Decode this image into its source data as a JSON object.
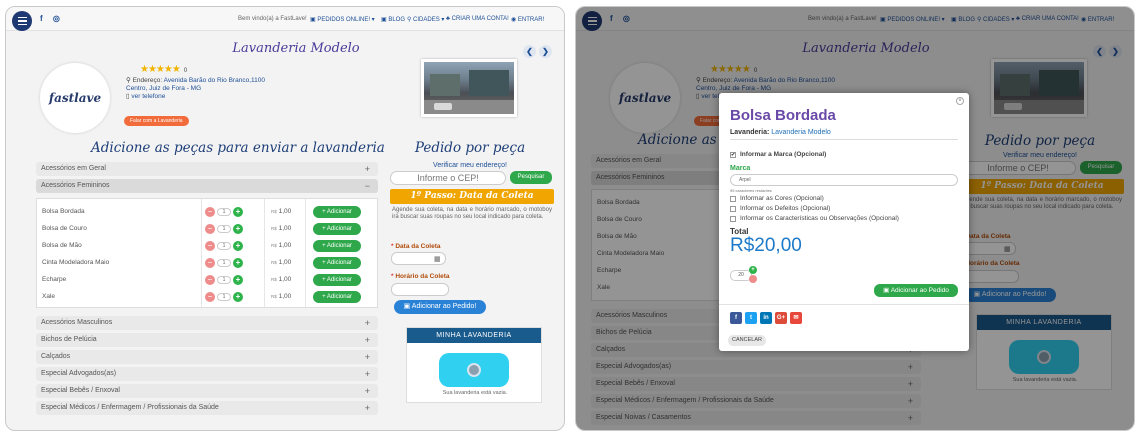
{
  "topbar": {
    "social": "f ◎",
    "welcome": "Bem vindo(a) a FastLave!",
    "pedidos": "▣ PEDIDOS ONLINE! ▾",
    "blog": "▣ BLOG",
    "cidades": "⚲ CIDADES ▾",
    "criar": "♣ CRIAR UMA CONTA!",
    "entrar": "◉ ENTRAR!"
  },
  "store": {
    "title": "Lavanderia Modelo",
    "logo": "fastlave",
    "stars": "★★★★★",
    "rating_count": "0",
    "address_label": "Endereço:",
    "address_line1": "Avenida Barão do Rio Branco,1100",
    "address_line2": "Centro, Juiz de Fora - MG",
    "phone_link": "ver telefone",
    "talk_button": "Falar com a Lavanderia"
  },
  "main": {
    "heading": "Adicione as peças para enviar a lavanderia",
    "categories_top": [
      "Acessórios em Geral",
      "Acessórios Femininos"
    ],
    "items": [
      {
        "name": "Bolsa Bordada",
        "qty": "1",
        "currency": "R$",
        "price": "1,00",
        "button": "+ Adicionar"
      },
      {
        "name": "Bolsa de Couro",
        "qty": "1",
        "currency": "R$",
        "price": "1,00",
        "button": "+ Adicionar"
      },
      {
        "name": "Bolsa de Mão",
        "qty": "1",
        "currency": "R$",
        "price": "1,00",
        "button": "+ Adicionar"
      },
      {
        "name": "Cinta Modeladora Maio",
        "qty": "1",
        "currency": "R$",
        "price": "1,00",
        "button": "+ Adicionar"
      },
      {
        "name": "Echarpe",
        "qty": "1",
        "currency": "R$",
        "price": "1,00",
        "button": "+ Adicionar"
      },
      {
        "name": "Xale",
        "qty": "1",
        "currency": "R$",
        "price": "1,00",
        "button": "+ Adicionar"
      }
    ],
    "categories_bottom": [
      "Acessórios Masculinos",
      "Bichos de Pelúcia",
      "Calçados",
      "Especial Advogados(as)",
      "Especial Bebês / Enxoval",
      "Especial Médicos / Enfermagem / Profissionais da Saúde"
    ],
    "categories_bottom_right": [
      "Acessórios Masculinos",
      "Bichos de Pelúcia",
      "Calçados",
      "Especial Advogados(as)",
      "Especial Bebês / Enxoval",
      "Especial Médicos / Enfermagem / Profissionais da Saúde",
      "Especial Noivas / Casamentos"
    ]
  },
  "pedido": {
    "title": "Pedido por peça",
    "verify": "Verificar meu endereço!",
    "cep_placeholder": "Informe o CEP!",
    "pesquisar": "Pesquisar",
    "passo": "1º Passo: Data da Coleta",
    "agende": "Agende sua coleta, na data e horário marcado, o motoboy irá buscar suas roupas no seu local indicado para coleta.",
    "data_label": "Data da Coleta",
    "hora_label": "Horário da Coleta",
    "add_button": "Adicionar ao Pedido!",
    "minha": "MINHA LAVANDERIA",
    "empty": "Sua lavanderia está vazia."
  },
  "modal": {
    "title": "Bolsa Bordada",
    "lav_label": "Lavanderia:",
    "lav_name": "Lavanderia Modelo",
    "informar_marca": "Informar a Marca (Opcional)",
    "marca_label": "Marca",
    "marca_value": "Arpel",
    "restantes": "95 caracteres restantes",
    "cores": "Informar as Cores (Opcional)",
    "defeitos": "Informar os Defeitos (Opcional)",
    "caracteristicas": "Informar os Características ou Observações (Opcional)",
    "total_label": "Total",
    "total": "R$20,00",
    "qty": "20",
    "add": "Adicionar ao Pedido",
    "cancel": "CANCELAR",
    "shares": [
      "f",
      "t",
      "in",
      "G+",
      "✉"
    ]
  },
  "colors": {
    "accent_green": "#2ea84a",
    "accent_blue": "#1e4f97",
    "passo_orange": "#f0a500",
    "minha_header": "#1a5b8e"
  }
}
